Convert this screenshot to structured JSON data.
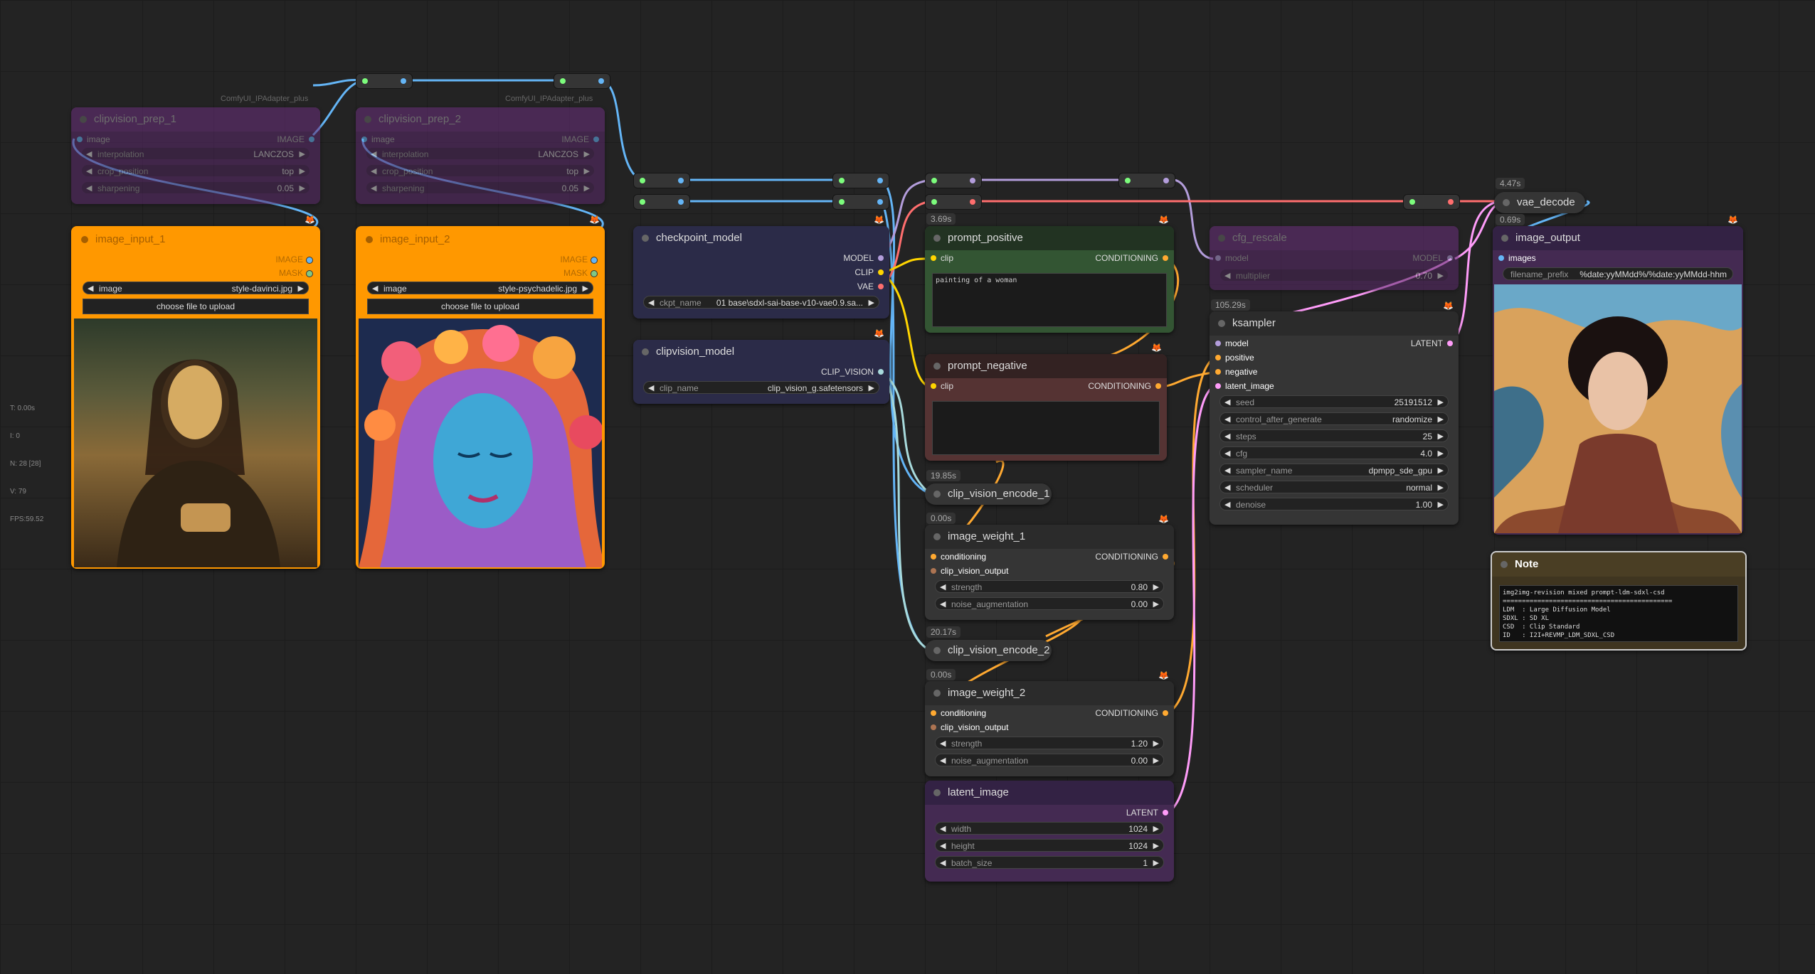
{
  "stats": [
    "T: 0.00s",
    "I: 0",
    "N: 28 [28]",
    "V: 79",
    "FPS:59.52"
  ],
  "colors": {
    "model": "#b39ddb",
    "clip": "#ffd500",
    "vae": "#ff6e6e",
    "conditioning": "#ffa931",
    "latent": "#ff9cf9",
    "image": "#64b5f6",
    "clip_vision": "#a8dadc",
    "clip_vision_output": "#ad7452"
  },
  "pack_labels": {
    "p1": "ComfyUI_IPAdapter_plus",
    "p2": "ComfyUI_IPAdapter_plus"
  },
  "prep1": {
    "title": "clipvision_prep_1",
    "in_image": "image",
    "out_image": "IMAGE",
    "widgets": [
      {
        "label": "interpolation",
        "value": "LANCZOS"
      },
      {
        "label": "crop_position",
        "value": "top"
      },
      {
        "label": "sharpening",
        "value": "0.05"
      }
    ]
  },
  "prep2": {
    "title": "clipvision_prep_2",
    "in_image": "image",
    "out_image": "IMAGE",
    "widgets": [
      {
        "label": "interpolation",
        "value": "LANCZOS"
      },
      {
        "label": "crop_position",
        "value": "top"
      },
      {
        "label": "sharpening",
        "value": "0.05"
      }
    ]
  },
  "input1": {
    "title": "image_input_1",
    "out_image": "IMAGE",
    "out_mask": "MASK",
    "image_label": "image",
    "image_value": "style-davinci.jpg",
    "upload": "choose file to upload"
  },
  "input2": {
    "title": "image_input_2",
    "out_image": "IMAGE",
    "out_mask": "MASK",
    "image_label": "image",
    "image_value": "style-psychadelic.jpg",
    "upload": "choose file to upload"
  },
  "ckpt": {
    "title": "checkpoint_model",
    "out_model": "MODEL",
    "out_clip": "CLIP",
    "out_vae": "VAE",
    "widget_label": "ckpt_name",
    "widget_value": "01 base\\sdxl-sai-base-v10-vae0.9.sa..."
  },
  "cvmodel": {
    "title": "clipvision_model",
    "out": "CLIP_VISION",
    "widget_label": "clip_name",
    "widget_value": "clip_vision_g.safetensors"
  },
  "pos": {
    "time": "3.69s",
    "title": "prompt_positive",
    "in_clip": "clip",
    "out": "CONDITIONING",
    "text": "painting of a woman"
  },
  "neg": {
    "title": "prompt_negative",
    "in_clip": "clip",
    "out": "CONDITIONING",
    "text": ""
  },
  "cve1": {
    "time": "19.85s",
    "title": "clip_vision_encode_1"
  },
  "iw1": {
    "time": "0.00s",
    "title": "image_weight_1",
    "in_cond": "conditioning",
    "in_cvo": "clip_vision_output",
    "out": "CONDITIONING",
    "widgets": [
      {
        "label": "strength",
        "value": "0.80"
      },
      {
        "label": "noise_augmentation",
        "value": "0.00"
      }
    ]
  },
  "cve2": {
    "time": "20.17s",
    "title": "clip_vision_encode_2"
  },
  "iw2": {
    "time": "0.00s",
    "title": "image_weight_2",
    "in_cond": "conditioning",
    "in_cvo": "clip_vision_output",
    "out": "CONDITIONING",
    "widgets": [
      {
        "label": "strength",
        "value": "1.20"
      },
      {
        "label": "noise_augmentation",
        "value": "0.00"
      }
    ]
  },
  "latent": {
    "title": "latent_image",
    "out": "LATENT",
    "widgets": [
      {
        "label": "width",
        "value": "1024"
      },
      {
        "label": "height",
        "value": "1024"
      },
      {
        "label": "batch_size",
        "value": "1"
      }
    ]
  },
  "cfgr": {
    "title": "cfg_rescale",
    "in_model": "model",
    "out_model": "MODEL",
    "widget_label": "multiplier",
    "widget_value": "0.70"
  },
  "ks": {
    "time": "105.29s",
    "title": "ksampler",
    "out": "LATENT",
    "inputs": [
      "model",
      "positive",
      "negative",
      "latent_image"
    ],
    "widgets": [
      {
        "label": "seed",
        "value": "25191512"
      },
      {
        "label": "control_after_generate",
        "value": "randomize"
      },
      {
        "label": "steps",
        "value": "25"
      },
      {
        "label": "cfg",
        "value": "4.0"
      },
      {
        "label": "sampler_name",
        "value": "dpmpp_sde_gpu"
      },
      {
        "label": "scheduler",
        "value": "normal"
      },
      {
        "label": "denoise",
        "value": "1.00"
      }
    ]
  },
  "vae": {
    "time": "4.47s",
    "title": "vae_decode"
  },
  "out": {
    "time": "0.69s",
    "title": "image_output",
    "in_images": "images",
    "prefix_label": "filename_prefix",
    "prefix_value": "%date:yyMMdd%/%date:yyMMdd-hhm"
  },
  "note": {
    "title": "Note",
    "text": "img2img-revision mixed prompt-ldm-sdxl-csd\n============================================\nLDM  : Large Diffusion Model\nSDXL : SD XL\nCSD  : Clip Standard\nID   : I2I+REVMP_LDM_SDXL_CSD"
  },
  "previews": {
    "mona": "Mona Lisa painting preview",
    "psy": "psychedelic floral portrait preview",
    "result": "generated portrait preview"
  }
}
